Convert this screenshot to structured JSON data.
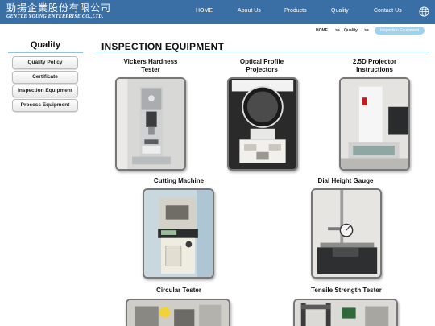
{
  "header": {
    "logo_cn": "勁揚企業股份有限公司",
    "logo_en": "GENTLE YOUNG ENTERPRISE CO.,LTD.",
    "nav": [
      "HOME",
      "About Us",
      "Products",
      "Quality",
      "Contact Us"
    ],
    "globe_icon": "globe-icon",
    "bg_color": "#3a6fa5"
  },
  "breadcrumb": {
    "home": "HOME",
    "sep1": ">>",
    "quality": "Quality",
    "sep2": ">>",
    "current": "Inspection Equipment"
  },
  "sidebar": {
    "title": "Quality",
    "items": [
      "Quality Policy",
      "Certificate",
      "Inspection Equipment",
      "Process Equipment"
    ]
  },
  "main": {
    "title": "INSPECTION EQUIPMENT",
    "equipment": [
      "Vickers Hardness Tester",
      "Optical Profile Projectors",
      "2.5D Projector Instructions",
      "Cutting Machine",
      "Dial Height Gauge",
      "Circular Tester",
      "Tensile Strength Tester"
    ]
  }
}
